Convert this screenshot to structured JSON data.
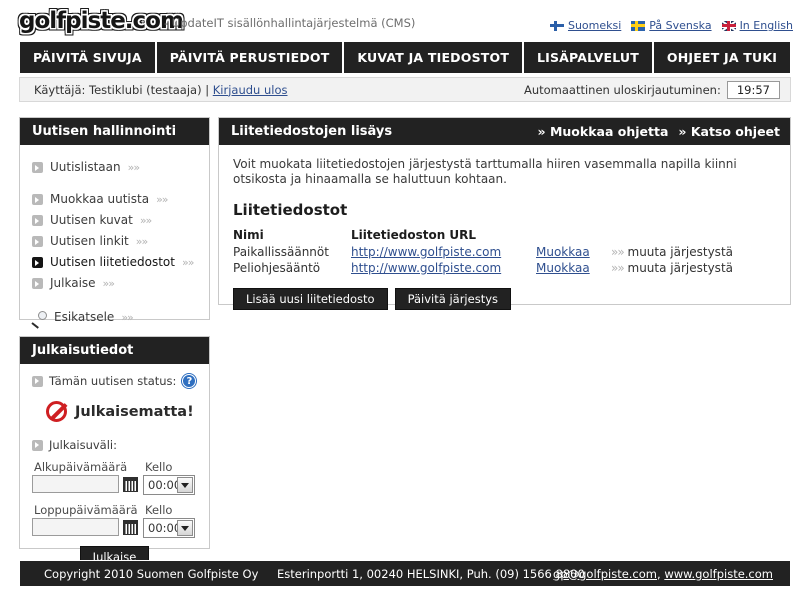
{
  "header": {
    "logo": "golfpiste.com",
    "tagline": "- UpdateIT sisällönhallintajärjestelmä (CMS)",
    "languages": [
      {
        "label": "Suomeksi",
        "flag": "finland-flag-icon"
      },
      {
        "label": "På Svenska",
        "flag": "sweden-flag-icon"
      },
      {
        "label": "In English",
        "flag": "uk-flag-icon"
      }
    ]
  },
  "nav": {
    "items": [
      {
        "label": "PÄIVITÄ SIVUJA"
      },
      {
        "label": "PÄIVITÄ PERUSTIEDOT"
      },
      {
        "label": "KUVAT JA TIEDOSTOT"
      },
      {
        "label": "LISÄPALVELUT"
      },
      {
        "label": "OHJEET JA TUKI"
      }
    ]
  },
  "userbar": {
    "user_text": "Käyttäjä: Testiklubi (testaaja) |",
    "logout_label": "Kirjaudu ulos",
    "autologout_label": "Automaattinen uloskirjautuminen:",
    "autologout_value": "19:57"
  },
  "sidebar": {
    "title": "Uutisen hallinnointi",
    "items": [
      {
        "label": "Uutislistaan",
        "chevron": "»»",
        "active": false
      },
      {
        "label": "Muokkaa uutista",
        "chevron": "»»",
        "active": false
      },
      {
        "label": "Uutisen kuvat",
        "chevron": "»»",
        "active": false
      },
      {
        "label": "Uutisen linkit",
        "chevron": "»»",
        "active": false
      },
      {
        "label": "Uutisen liitetiedostot",
        "chevron": "»»",
        "active": true
      },
      {
        "label": "Julkaise",
        "chevron": "»»",
        "active": false
      }
    ],
    "preview": {
      "label": "Esikatsele",
      "chevron": "»»"
    }
  },
  "publish": {
    "title": "Julkaisutiedot",
    "status_label": "Tämän uutisen status:",
    "help_icon_text": "?",
    "status_value": "Julkaisematta!",
    "interval_label": "Julkaisuväli:",
    "start_date_label": "Alkupäivämäärä",
    "start_date_value": "",
    "start_time_label": "Kello",
    "start_time_value": "00:00",
    "end_date_label": "Loppupäivämäärä",
    "end_date_value": "",
    "end_time_label": "Kello",
    "end_time_value": "00:00",
    "publish_button": "Julkaise"
  },
  "main": {
    "title": "Liitetiedostojen lisäys",
    "head_links": [
      {
        "label": "» Muokkaa ohjetta"
      },
      {
        "label": "» Katso ohjeet"
      }
    ],
    "intro": "Voit muokata liitetiedostojen järjestystä tarttumalla hiiren vasemmalla napilla kiinni otsikosta ja hinaamalla se haluttuun kohtaan.",
    "section_title": "Liitetiedostot",
    "table": {
      "headers": [
        "Nimi",
        "Liitetiedoston URL",
        "",
        ""
      ],
      "rows": [
        {
          "name": "Paikallissäännöt",
          "url": "http://www.golfpiste.com",
          "edit": "Muokkaa",
          "reorder_arrows": "»»",
          "reorder": "muuta järjestystä"
        },
        {
          "name": "Peliohjesääntö",
          "url": "http://www.golfpiste.com",
          "edit": "Muokkaa",
          "reorder_arrows": "»»",
          "reorder": "muuta järjestystä"
        }
      ]
    },
    "buttons": [
      {
        "label": "Lisää uusi liitetiedosto"
      },
      {
        "label": "Päivitä järjestys"
      }
    ]
  },
  "footer": {
    "copyright": "Copyright 2010 Suomen Golfpiste Oy",
    "address": "Esterinportti 1, 00240 HELSINKI, Puh. (09) 1566 8800",
    "email": "gp@golfpiste.com",
    "separator": ",",
    "website": "www.golfpiste.com"
  },
  "colors": {
    "dark": "#222222",
    "link": "#2f4f8f",
    "status_red": "#cf1f22"
  }
}
